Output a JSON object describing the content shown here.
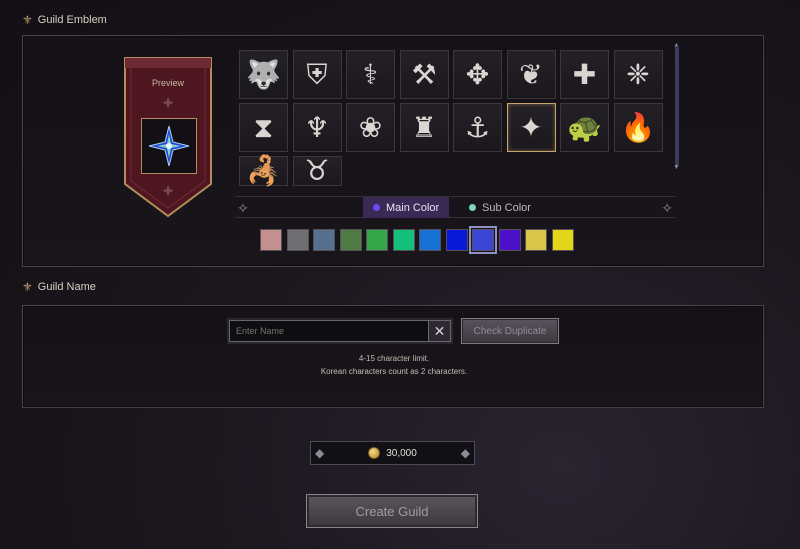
{
  "emblem_section": {
    "title": "Guild Emblem",
    "preview_label": "Preview",
    "emblems": [
      {
        "icon": "wolf-icon",
        "glyph": "🐺"
      },
      {
        "icon": "shield-icon",
        "glyph": "⛨"
      },
      {
        "icon": "caduceus-icon",
        "glyph": "⚕"
      },
      {
        "icon": "hammer-sword-icon",
        "glyph": "⚒"
      },
      {
        "icon": "blades-icon",
        "glyph": "✥"
      },
      {
        "icon": "maple-leaf-icon",
        "glyph": "❦"
      },
      {
        "icon": "cross-icon",
        "glyph": "✚"
      },
      {
        "icon": "wings-icon",
        "glyph": "❈"
      },
      {
        "icon": "hourglass-icon",
        "glyph": "⧗"
      },
      {
        "icon": "lyre-icon",
        "glyph": "♆"
      },
      {
        "icon": "rose-icon",
        "glyph": "❀"
      },
      {
        "icon": "helmet-icon",
        "glyph": "♜"
      },
      {
        "icon": "anchor-icon",
        "glyph": "⚓"
      },
      {
        "icon": "star-flower-icon",
        "glyph": "✦"
      },
      {
        "icon": "turtle-icon",
        "glyph": "🐢"
      },
      {
        "icon": "book-flame-icon",
        "glyph": "🔥"
      },
      {
        "icon": "scorpion-icon",
        "glyph": "🦂"
      },
      {
        "icon": "bull-skull-icon",
        "glyph": "♉"
      }
    ],
    "selected_index": 13,
    "tabs": [
      {
        "label": "Main Color",
        "dot_color": "#6b4cf0"
      },
      {
        "label": "Sub Color",
        "dot_color": "#7fd6c4"
      }
    ],
    "swatches": [
      "#c58f8f",
      "#6f6f72",
      "#56708f",
      "#4f7a43",
      "#35a64a",
      "#12c07a",
      "#1872d6",
      "#0a19d8",
      "#3a46d6",
      "#4c10c8",
      "#d8c64a",
      "#e2d51a"
    ],
    "selected_swatch": 8
  },
  "name_section": {
    "title": "Guild Name",
    "input_placeholder": "Enter Name",
    "check_button": "Check Duplicate",
    "hint_line1": "4-15 character limit.",
    "hint_line2": "Korean characters count as 2 characters."
  },
  "cost": {
    "amount": "30,000"
  },
  "create_button": "Create Guild"
}
